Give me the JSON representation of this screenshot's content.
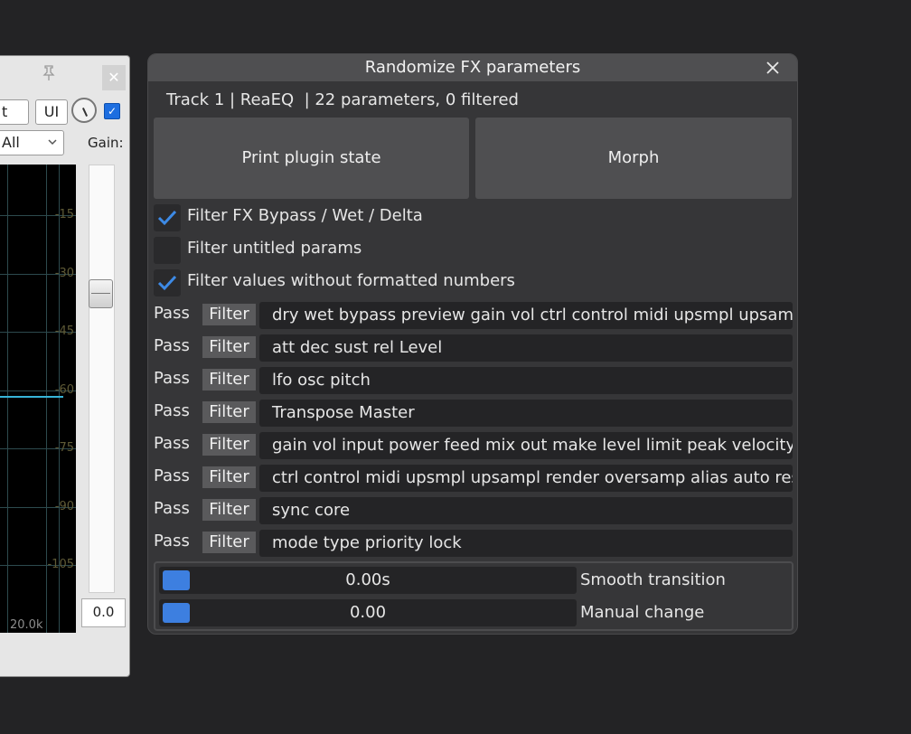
{
  "left_window": {
    "close_glyph": "✕",
    "field_text": "t",
    "ui_button": "UI",
    "dropdown_value": "All",
    "gain_label": "Gain:",
    "db_labels": [
      "-15",
      "-30",
      "-45",
      "-60",
      "-75",
      "-90",
      "-105"
    ],
    "freq_label": "20.0k",
    "gain_value": "0.0"
  },
  "dialog": {
    "title": "Randomize FX parameters",
    "info": "Track 1 | ReaEQ  | 22 parameters, 0 filtered",
    "buttons": {
      "print": "Print plugin state",
      "morph": "Morph"
    },
    "checkboxes": [
      {
        "label": "Filter FX Bypass / Wet / Delta",
        "checked": true
      },
      {
        "label": "Filter untitled params",
        "checked": false
      },
      {
        "label": "Filter values without formatted numbers",
        "checked": true
      }
    ],
    "filters": [
      {
        "pass": "Pass",
        "filter": "Filter",
        "value": "dry wet bypass preview gain vol ctrl control midi upsmpl upsampl"
      },
      {
        "pass": "Pass",
        "filter": "Filter",
        "value": "att dec sust rel Level"
      },
      {
        "pass": "Pass",
        "filter": "Filter",
        "value": "lfo osc pitch"
      },
      {
        "pass": "Pass",
        "filter": "Filter",
        "value": "Transpose Master"
      },
      {
        "pass": "Pass",
        "filter": "Filter",
        "value": "gain vol input power feed mix out make level limit peak velocity vo"
      },
      {
        "pass": "Pass",
        "filter": "Filter",
        "value": "ctrl control midi upsmpl upsampl render oversamp alias auto resv"
      },
      {
        "pass": "Pass",
        "filter": "Filter",
        "value": "sync core"
      },
      {
        "pass": "Pass",
        "filter": "Filter",
        "value": "mode type priority lock"
      }
    ],
    "sliders": [
      {
        "value": "0.00s",
        "label": "Smooth transition"
      },
      {
        "value": "0.00",
        "label": "Manual change"
      }
    ],
    "accent_color": "#3d7fe0"
  }
}
